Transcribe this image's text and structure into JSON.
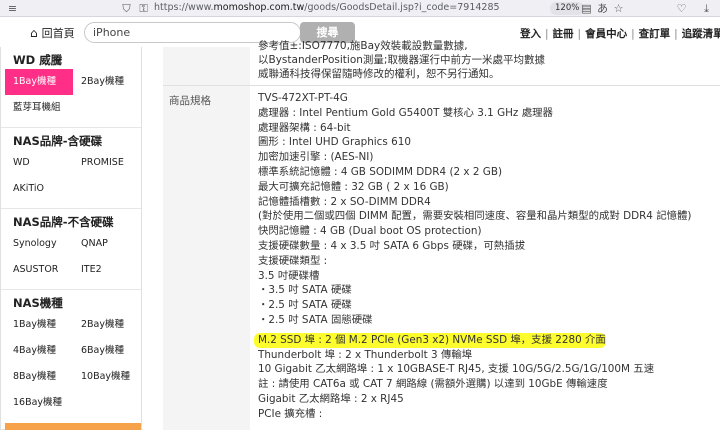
{
  "browser": {
    "url_prefix": "https://www.",
    "url_host": "momoshop.com.tw",
    "url_path": "/goods/GoodsDetail.jsp?i_code=7914285",
    "zoom": "120%",
    "icons": [
      "shield-icon",
      "lock-icon",
      "page-icon",
      "translate-icon",
      "star-icon",
      "pocket-icon",
      "download-icon"
    ]
  },
  "header": {
    "home_label": "回首頁",
    "search_value": "iPhone",
    "search_button": "搜尋",
    "nav": [
      "登入",
      "註冊",
      "會員中心",
      "查訂單",
      "追蹤清單"
    ]
  },
  "sidebar": {
    "sections": [
      {
        "title": "WD 威騰",
        "items": [
          "1Bay機種",
          "2Bay機種",
          "藍芽耳機組"
        ]
      },
      {
        "title": "NAS品牌-含硬碟",
        "items": [
          "WD",
          "PROMISE",
          "AKiTiO"
        ]
      },
      {
        "title": "NAS品牌-不含硬碟",
        "items": [
          "Synology",
          "QNAP",
          "ASUSTOR",
          "ITE2"
        ]
      },
      {
        "title": "NAS機種",
        "items": [
          "1Bay機種",
          "2Bay機種",
          "4Bay機種",
          "6Bay機種",
          "8Bay機種",
          "10Bay機種",
          "16Bay機種"
        ]
      }
    ],
    "active_item": "1Bay機種",
    "accent_color": "#ff2f87"
  },
  "spec": {
    "previous_lines": [
      "參考值±:ISO7770,施Bay效裝載設數量數據,",
      "以BystanderPosition測量;取機器運行中前方一米處平均數據",
      "威聯通科技得保留隨時修改的權利，恕不另行通知。"
    ],
    "label": "商品規格",
    "lines": [
      "TVS-472XT-PT-4G",
      "處理器 : Intel Pentium Gold G5400T 雙核心 3.1 GHz 處理器",
      "處理器架構 : 64-bit",
      "圖形 : Intel UHD Graphics 610",
      "加密加速引擎 : (AES-NI)",
      "標準系統記憶體 : 4 GB SODIMM DDR4 (2 x 2 GB)",
      "最大可擴充記憶體 : 32 GB ( 2 x 16 GB)",
      "記憶體插槽數 : 2 x SO-DIMM DDR4",
      "(對於使用二個或四個 DIMM 配置，需要安裝相同速度、容量和晶片類型的成對 DDR4 記憶體)",
      "快閃記憶體 : 4 GB (Dual boot OS protection)",
      "支援硬碟數量 : 4 x 3.5 吋 SATA 6 Gbps 硬碟，可熱插拔",
      "支援硬碟類型 :",
      "3.5 吋硬碟槽",
      "・3.5 吋 SATA 硬碟",
      "・2.5 吋 SATA 硬碟",
      "・2.5 吋 SATA 固態硬碟",
      "M.2 SSD 埠 : 2 個 M.2 PCIe (Gen3 x2) NVMe SSD 埠，支援 2280 介面",
      "Thunderbolt 埠 : 2 x Thunderbolt 3 傳輸埠",
      "10 Gigabit 乙太網路埠 : 1 x 10GBASE-T RJ45, 支援 10G/5G/2.5G/1G/100M 五速",
      "註 : 請使用 CAT6a 或 CAT 7 網路線 (需額外選購) 以達到 10GbE 傳輸速度",
      "Gigabit 乙太網路埠 : 2 x RJ45",
      "PCIe 擴充槽 :"
    ],
    "highlight_index": 16,
    "highlight_color": "#fdfc2d"
  }
}
